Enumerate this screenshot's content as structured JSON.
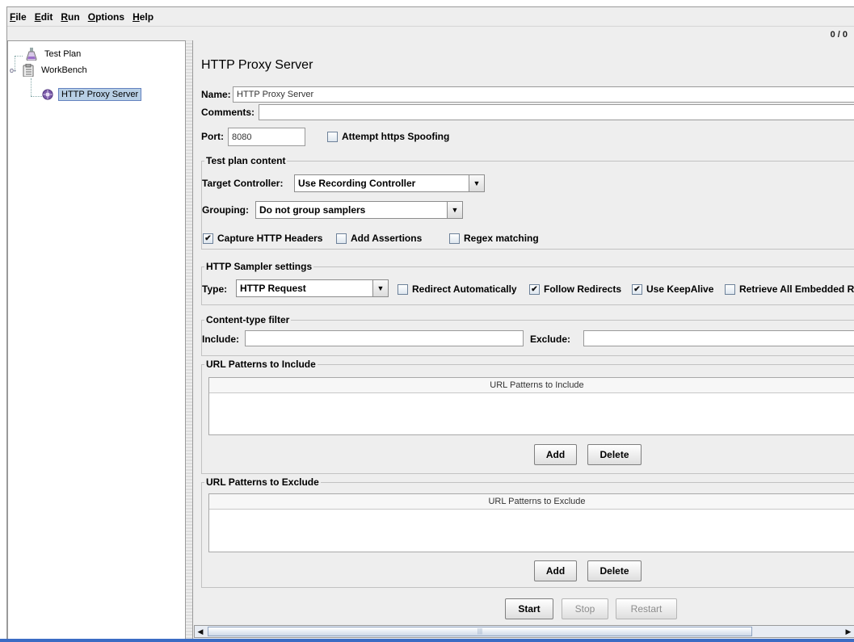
{
  "menu": {
    "file": {
      "first": "F",
      "rest": "ile"
    },
    "edit": {
      "first": "E",
      "rest": "dit"
    },
    "run": {
      "first": "R",
      "rest": "un"
    },
    "options": {
      "first": "O",
      "rest": "ptions"
    },
    "help": {
      "first": "H",
      "rest": "elp"
    }
  },
  "status_counter": "0 / 0",
  "tree": {
    "test_plan": "Test Plan",
    "workbench": "WorkBench",
    "http_proxy_server": "HTTP Proxy Server"
  },
  "panel": {
    "title": "HTTP Proxy Server",
    "name_label": "Name:",
    "name_value": "HTTP Proxy Server",
    "comments_label": "Comments:",
    "comments_value": "",
    "port_label": "Port:",
    "port_value": "8080",
    "attempt_https_spoofing": {
      "label": "Attempt https Spoofing",
      "checked": false
    }
  },
  "test_plan_content": {
    "title": "Test plan content",
    "target_controller_label": "Target Controller:",
    "target_controller_value": "Use Recording Controller",
    "grouping_label": "Grouping:",
    "grouping_value": "Do not group samplers",
    "capture_http_headers": {
      "label": "Capture HTTP Headers",
      "checked": true
    },
    "add_assertions": {
      "label": "Add Assertions",
      "checked": false
    },
    "regex_matching": {
      "label": "Regex matching",
      "checked": false
    }
  },
  "http_sampler_settings": {
    "title": "HTTP Sampler settings",
    "type_label": "Type:",
    "type_value": "HTTP Request",
    "redirect_automatically": {
      "label": "Redirect Automatically",
      "checked": false
    },
    "follow_redirects": {
      "label": "Follow Redirects",
      "checked": true
    },
    "use_keepalive": {
      "label": "Use KeepAlive",
      "checked": true
    },
    "retrieve_all_embedded": {
      "label": "Retrieve All Embedded Res",
      "checked": false
    }
  },
  "content_type_filter": {
    "title": "Content-type filter",
    "include_label": "Include:",
    "include_value": "",
    "exclude_label": "Exclude:",
    "exclude_value": ""
  },
  "url_include": {
    "title": "URL Patterns to Include",
    "column_header": "URL Patterns to Include",
    "add_label": "Add",
    "delete_label": "Delete"
  },
  "url_exclude": {
    "title": "URL Patterns to Exclude",
    "column_header": "URL Patterns to Exclude",
    "add_label": "Add",
    "delete_label": "Delete"
  },
  "controls": {
    "start_label": "Start",
    "stop_label": "Stop",
    "restart_label": "Restart"
  },
  "check_glyph": "✔",
  "colors": {
    "selection": "#b8cfe5",
    "panel_bg": "#eeeeee",
    "scroll_accent": "#3b6cc4"
  }
}
